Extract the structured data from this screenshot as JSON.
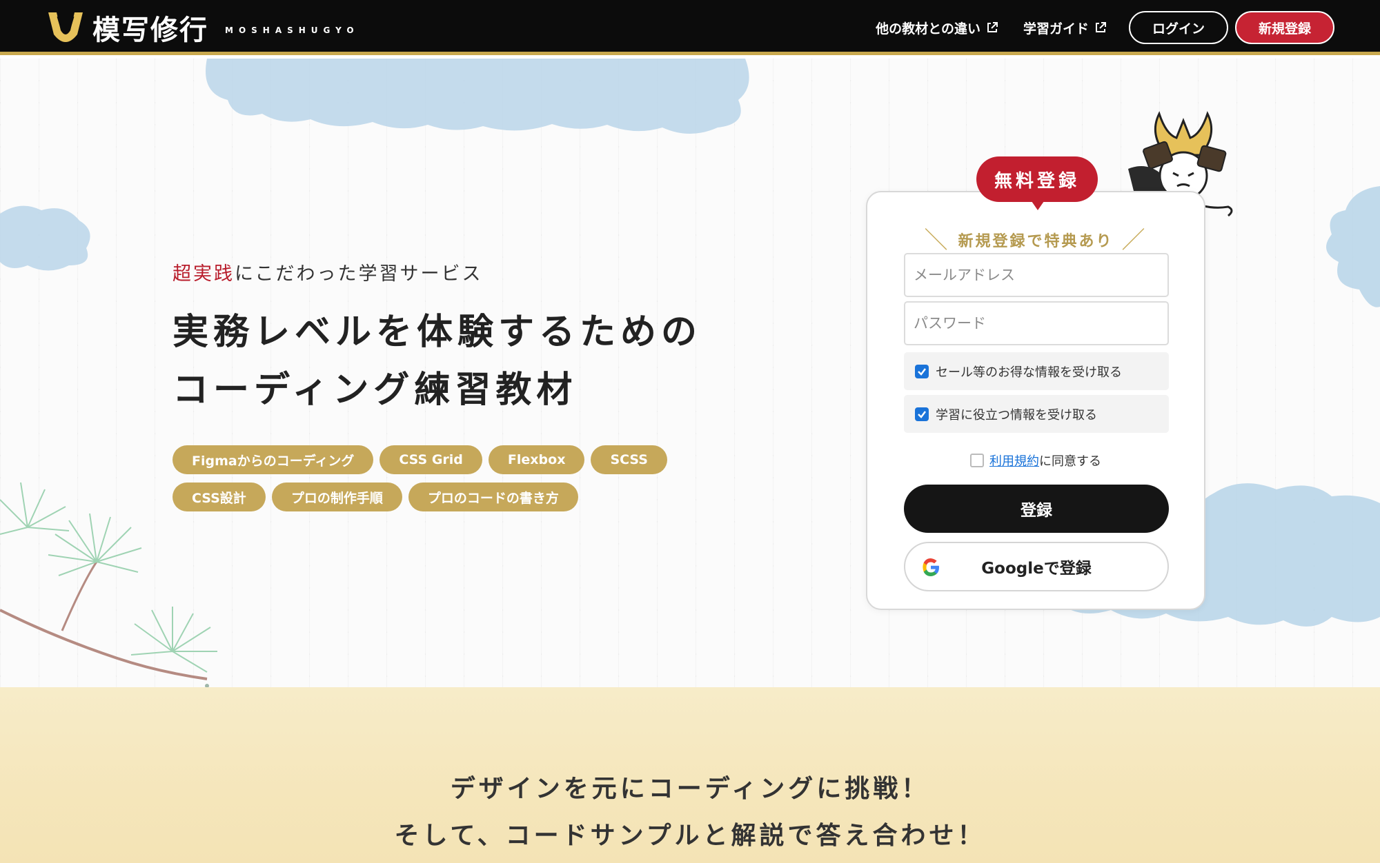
{
  "header": {
    "logo_text": "模写修行",
    "logo_sub": "MOSHASHUGYO",
    "nav": [
      {
        "label": "他の教材との違い"
      },
      {
        "label": "学習ガイド"
      }
    ],
    "login_label": "ログイン",
    "signup_label": "新規登録"
  },
  "hero": {
    "tagline_accent": "超実践",
    "tagline_rest": "にこだわった学習サービス",
    "headline_line1": "実務レベルを体験するための",
    "headline_line2": "コーディング練習教材",
    "tags": [
      "Figmaからのコーディング",
      "CSS Grid",
      "Flexbox",
      "SCSS",
      "CSS設計",
      "プロの制作手順",
      "プロのコードの書き方"
    ]
  },
  "signup_card": {
    "ribbon": "無料登録",
    "perk": "新規登録で特典あり",
    "email_placeholder": "メールアドレス",
    "password_placeholder": "パスワード",
    "check_sale": "セール等のお得な情報を受け取る",
    "check_learning": "学習に役立つ情報を受け取る",
    "check_sale_checked": true,
    "check_learning_checked": true,
    "terms_checked": false,
    "terms_link": "利用規約",
    "terms_rest": "に同意する",
    "register_label": "登録",
    "google_label": "Googleで登録"
  },
  "lower": {
    "line1": "デザインを元にコーディングに挑戦！",
    "line2": "そして、コードサンプルと解説で答え合わせ！"
  },
  "colors": {
    "gold": "#c6a85a",
    "red": "#c21f2f",
    "dark": "#0c0c0c",
    "link_blue": "#1a73d9"
  }
}
